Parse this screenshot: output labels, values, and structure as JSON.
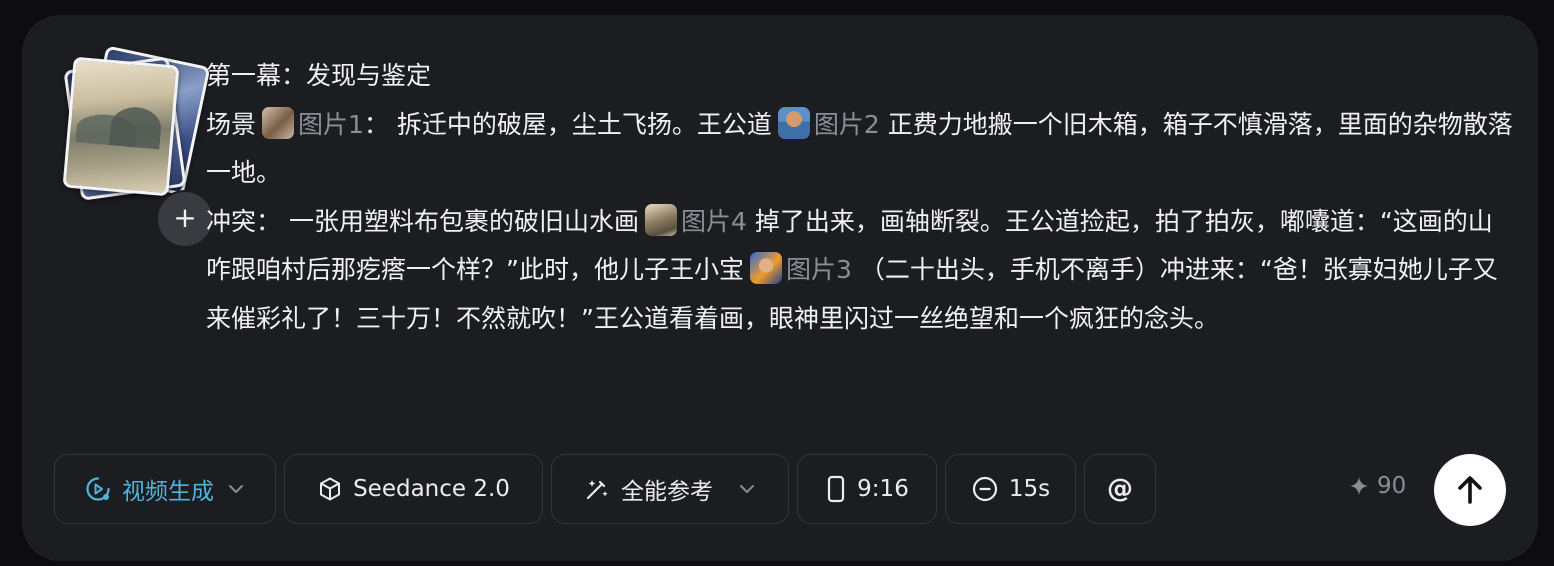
{
  "attachments": {
    "add_label": "+"
  },
  "prompt": {
    "act_title": "第一幕：发现与鉴定",
    "scene_label": "场景",
    "ref1": "图片1",
    "scene_sep": "：",
    "scene_text_1": "拆迁中的破屋，尘土飞扬。王公道",
    "ref2": "图片2",
    "scene_text_2": "正费力地搬一个旧木箱，箱子不慎滑落，里面的杂物散落一地。",
    "conflict_label": "冲突：",
    "conflict_text_1": "一张用塑料布包裹的破旧山水画",
    "ref4": "图片4",
    "conflict_text_2": "掉了出来，画轴断裂。王公道捡起，拍了拍灰，嘟囔道：“这画的山咋跟咱村后那疙瘩一个样？”此时，他儿子王小宝",
    "ref3": "图片3",
    "conflict_text_3": "（二十出头，手机不离手）冲进来：“爸！张寡妇她儿子又来催彩礼了！三十万！不然就吹！”王公道看着画，眼神里闪过一丝绝望和一个疯狂的念头。"
  },
  "toolbar": {
    "mode_label": "视频生成",
    "model_label": "Seedance 2.0",
    "reference_label": "全能参考",
    "ratio_label": "9:16",
    "duration_label": "15s",
    "mention_label": "@"
  },
  "credits": {
    "value": "90"
  },
  "colors": {
    "accent": "#4fb3de",
    "panel": "#1c1d21",
    "background": "#0d0d0f"
  }
}
